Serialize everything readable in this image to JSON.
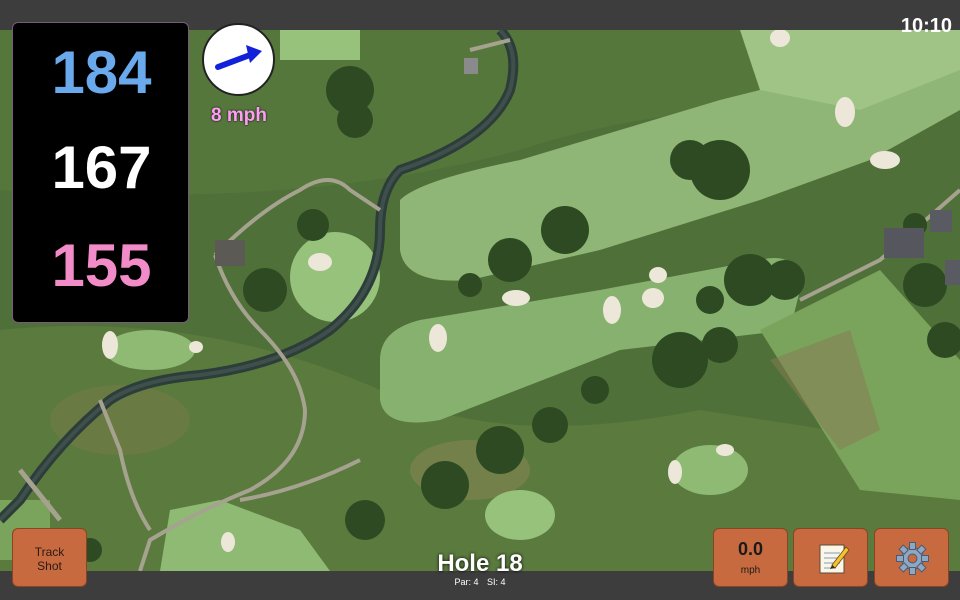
{
  "status_bar": {
    "time": "10:10"
  },
  "distances": {
    "back": "184",
    "middle": "167",
    "front": "155",
    "colors": {
      "back": "#6aa9ec",
      "middle": "#ffffff",
      "front": "#f28cc9"
    }
  },
  "wind": {
    "speed_label": "8 mph",
    "arrow_icon": "wind-direction-arrow-icon",
    "arrow_color": "#1222d8"
  },
  "buttons": {
    "track_shot": "Track\nShot",
    "speed_value": "0.0",
    "speed_unit": "mph",
    "notes_icon": "notepad-icon",
    "settings_icon": "gear-icon",
    "accent": "#c86a40"
  },
  "hole": {
    "title": "Hole 18",
    "par": "Par: 4",
    "si": "SI: 4"
  }
}
